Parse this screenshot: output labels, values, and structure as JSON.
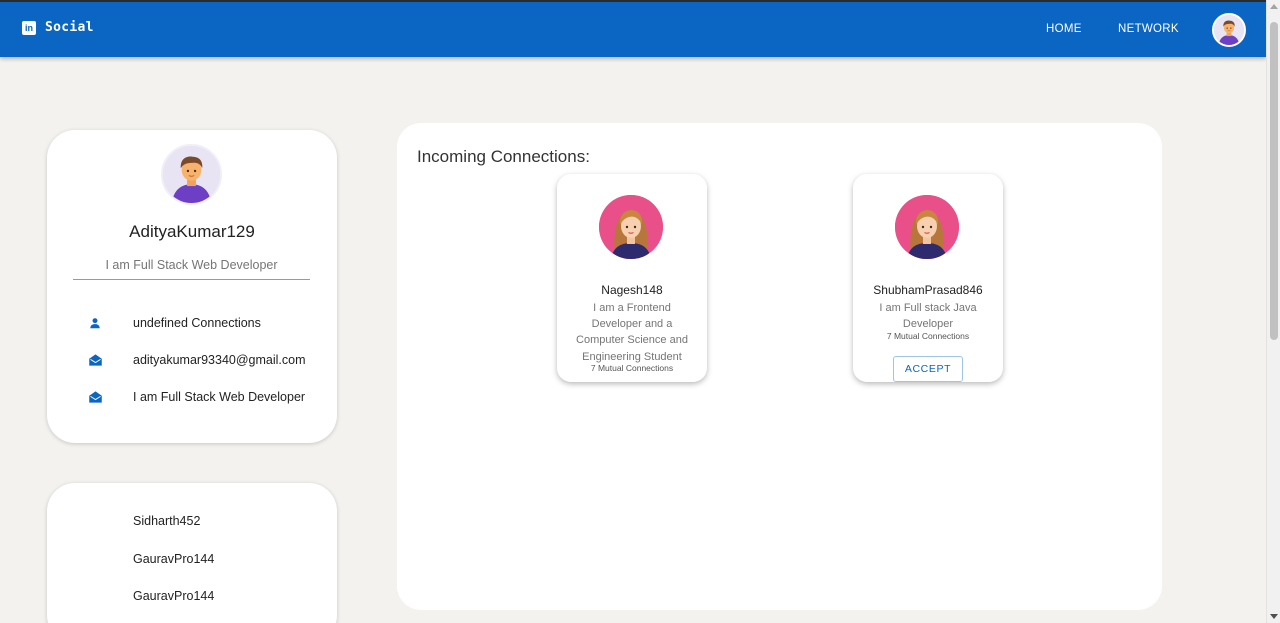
{
  "header": {
    "brand_logo_text": "in",
    "brand_name": "Social",
    "nav": [
      {
        "label": "HOME"
      },
      {
        "label": "NETWORK"
      }
    ],
    "colors": {
      "bar": "#0a66c2",
      "page_background": "#f3f2ef"
    }
  },
  "profile": {
    "username": "AdityaKumar129",
    "headline": "I am Full Stack Web Developer",
    "info": [
      {
        "icon": "person-icon",
        "text": "undefined Connections"
      },
      {
        "icon": "mail-icon",
        "text": "adityakumar93340@gmail.com"
      },
      {
        "icon": "mail-icon",
        "text": "I am Full Stack Web Developer"
      }
    ]
  },
  "connections_list": [
    {
      "name": "Sidharth452"
    },
    {
      "name": "GauravPro144"
    },
    {
      "name": "GauravPro144"
    }
  ],
  "incoming": {
    "title": "Incoming Connections:",
    "cards": [
      {
        "name": "Nagesh148",
        "bio": "I am a Frontend Developer and a Computer Science and Engineering Student",
        "mutual": "7 Mutual Connections"
      },
      {
        "name": "ShubhamPrasad846",
        "bio": "I am Full stack Java Developer",
        "mutual": "7 Mutual Connections",
        "action": "ACCEPT"
      }
    ]
  }
}
